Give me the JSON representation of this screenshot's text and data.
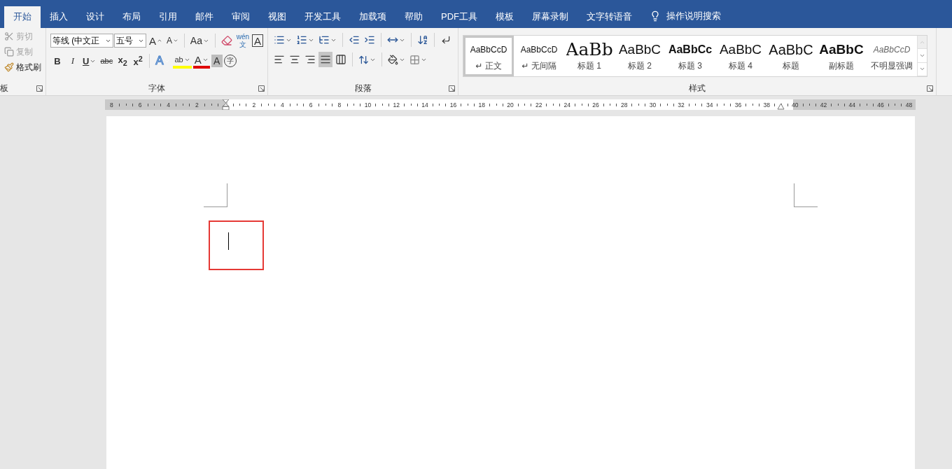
{
  "tabs": [
    {
      "label": "开始",
      "selected": true
    },
    {
      "label": "插入",
      "selected": false
    },
    {
      "label": "设计",
      "selected": false
    },
    {
      "label": "布局",
      "selected": false
    },
    {
      "label": "引用",
      "selected": false
    },
    {
      "label": "邮件",
      "selected": false
    },
    {
      "label": "审阅",
      "selected": false
    },
    {
      "label": "视图",
      "selected": false
    },
    {
      "label": "开发工具",
      "selected": false
    },
    {
      "label": "加载项",
      "selected": false
    },
    {
      "label": "帮助",
      "selected": false
    },
    {
      "label": "PDF工具",
      "selected": false
    },
    {
      "label": "模板",
      "selected": false
    },
    {
      "label": "屏幕录制",
      "selected": false
    },
    {
      "label": "文字转语音",
      "selected": false
    }
  ],
  "tell_me": {
    "label": "操作说明搜索"
  },
  "clipboard": {
    "label": "板",
    "items": [
      {
        "kind": "cut",
        "label": "剪切",
        "disabled": true
      },
      {
        "kind": "copy",
        "label": "复制",
        "disabled": true
      },
      {
        "kind": "painter",
        "label": "格式刷",
        "disabled": false
      }
    ]
  },
  "font": {
    "label": "字体",
    "font_name": "等线 (中文正",
    "font_size": "五号",
    "row1": [
      {
        "kind": "grow",
        "label": "A"
      },
      {
        "kind": "shrink",
        "label": "A"
      },
      {
        "kind": "case",
        "label": "Aa"
      },
      {
        "kind": "clear"
      },
      {
        "kind": "phonetic",
        "label": "wén",
        "sub": "文"
      },
      {
        "kind": "border",
        "label": "A"
      }
    ],
    "row2": [
      {
        "kind": "bold",
        "label": "B"
      },
      {
        "kind": "italic",
        "label": "I"
      },
      {
        "kind": "underline",
        "label": "U"
      },
      {
        "kind": "strike",
        "label": "abc"
      },
      {
        "kind": "plain",
        "label": "x$_{2}$"
      },
      {
        "kind": "plain",
        "label": "x$^{2}$"
      },
      {
        "kind": "effects",
        "label": "A"
      },
      {
        "kind": "highlight",
        "label": "ab"
      },
      {
        "kind": "color",
        "label": "A"
      },
      {
        "kind": "shading",
        "label": "A"
      },
      {
        "kind": "enclose",
        "label": "字"
      }
    ]
  },
  "paragraph": {
    "label": "段落",
    "alignment": [
      {
        "kind": "left",
        "selected": false
      },
      {
        "kind": "center",
        "selected": false
      },
      {
        "kind": "right",
        "selected": false
      },
      {
        "kind": "justify",
        "selected": true
      },
      {
        "kind": "distributed",
        "selected": false
      }
    ]
  },
  "styles": {
    "label": "样式",
    "items": [
      {
        "preview": "AaBbCcD",
        "kind": "normal",
        "name": "正文",
        "mark": "↵",
        "selected": true
      },
      {
        "preview": "AaBbCcD",
        "kind": "normal",
        "name": "无间隔",
        "mark": "↵",
        "selected": false
      },
      {
        "preview": "AaBb",
        "kind": "heading1",
        "name": "标题 1",
        "selected": false
      },
      {
        "preview": "AaBbC",
        "kind": "heading2",
        "name": "标题 2",
        "selected": false
      },
      {
        "preview": "AaBbCc",
        "kind": "heading3",
        "name": "标题 3",
        "selected": false
      },
      {
        "preview": "AaBbC",
        "kind": "heading2",
        "name": "标题 4",
        "selected": false
      },
      {
        "preview": "AaBbC",
        "kind": "title",
        "name": "标题",
        "selected": false
      },
      {
        "preview": "AaBbC",
        "kind": "subtitle",
        "name": "副标题",
        "selected": false
      },
      {
        "preview": "AaBbCcD",
        "kind": "emphasis",
        "name": "不明显强调",
        "selected": false
      }
    ]
  },
  "ruler": {
    "left_numbers": [
      "8",
      "6",
      "4",
      "2"
    ],
    "right_numbers": [
      "2",
      "4",
      "6",
      "8",
      "10",
      "12",
      "14",
      "16",
      "18",
      "20",
      "22",
      "24",
      "26",
      "28",
      "30",
      "32",
      "34",
      "36",
      "38",
      "40",
      "42",
      "44",
      "46",
      "48"
    ]
  },
  "document": {
    "annotation": {
      "kind": "rectangle"
    }
  }
}
